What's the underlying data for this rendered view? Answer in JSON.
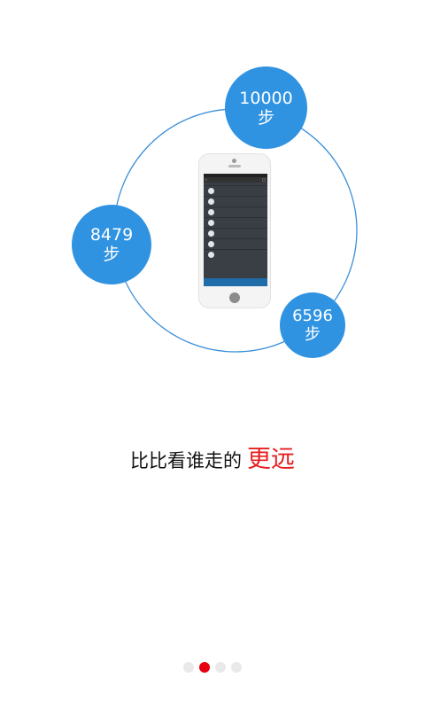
{
  "bubbles": [
    {
      "value": "10000",
      "unit": "步"
    },
    {
      "value": "8479",
      "unit": "步"
    },
    {
      "value": "6596",
      "unit": "步"
    }
  ],
  "colors": {
    "bubble": "#2f93e2",
    "highlight": "#e61e1e",
    "dot_active": "#e60012",
    "dot_inactive": "#e9e9e9"
  },
  "slogan": {
    "text": "比比看谁走的",
    "highlight": "更远"
  },
  "pager": {
    "count": 4,
    "active_index": 1
  }
}
